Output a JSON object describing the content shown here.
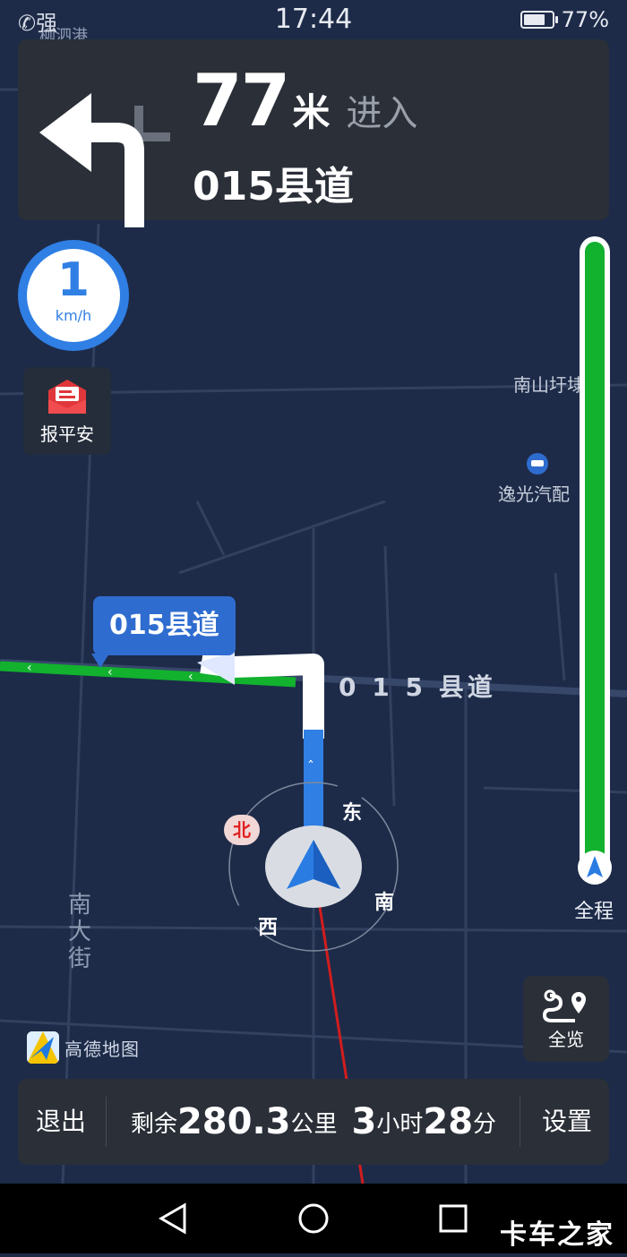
{
  "status_bar": {
    "signal_text": "强",
    "time": "17:44",
    "battery_percent": "77%",
    "battery_level": 0.77
  },
  "maneuver": {
    "distance_value": "77",
    "distance_unit": "米",
    "action": "进入",
    "road_name": "015县道",
    "direction": "turn-left"
  },
  "speed": {
    "value": "1",
    "unit": "km/h"
  },
  "safe_report": {
    "label": "报平安"
  },
  "route_progress": {
    "label": "全程",
    "fraction_completed": 0.02
  },
  "overview_button": {
    "label": "全览"
  },
  "brand": {
    "logo_text": "高德地图"
  },
  "map": {
    "poi_labels": [
      "南山圩埭",
      "逸光汽配"
    ],
    "top_clipped_label": "柳泗港",
    "road_label": "0 1 5 县道",
    "vertical_street": "南大街",
    "callout": "015县道",
    "compass": {
      "north": "北",
      "east": "东",
      "south": "南",
      "west": "西"
    }
  },
  "bottom_bar": {
    "exit_label": "退出",
    "remaining_prefix": "剩余",
    "remaining_distance": "280.3",
    "distance_unit": "公里",
    "time_hours": "3",
    "hours_unit": "小时",
    "time_minutes": "28",
    "minutes_unit": "分",
    "settings_label": "设置"
  },
  "android_nav": {
    "buttons": [
      "back",
      "home",
      "recents"
    ]
  },
  "watermark": "卡车之家",
  "colors": {
    "map_background": "#1d2b49",
    "card_background": "#2a2f38",
    "route_green": "#12b12e",
    "route_blue": "#2f7fe4",
    "accent_blue": "#2f6ccf"
  }
}
